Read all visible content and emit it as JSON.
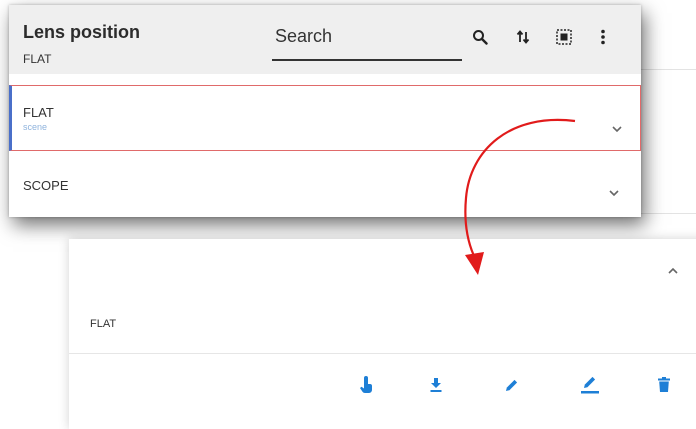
{
  "header": {
    "title": "Lens position",
    "subtitle": "FLAT",
    "search_placeholder": "Search"
  },
  "toolbar": {
    "icons": [
      "search-icon",
      "sort-icon",
      "select-all-icon",
      "more-vertical-icon"
    ]
  },
  "list": {
    "items": [
      {
        "label": "FLAT",
        "sublabel": "scene",
        "selected": true
      },
      {
        "label": "SCOPE",
        "sublabel": "",
        "selected": false
      }
    ]
  },
  "detail": {
    "label": "FLAT",
    "actions": [
      "touch-select-icon",
      "download-icon",
      "edit-icon",
      "rename-icon",
      "delete-icon"
    ]
  },
  "colors": {
    "accent_blue": "#1e7fd6",
    "selection_border": "#e06a6a",
    "selection_left": "#4a6fc9",
    "callout_arrow": "#e11b1b"
  }
}
